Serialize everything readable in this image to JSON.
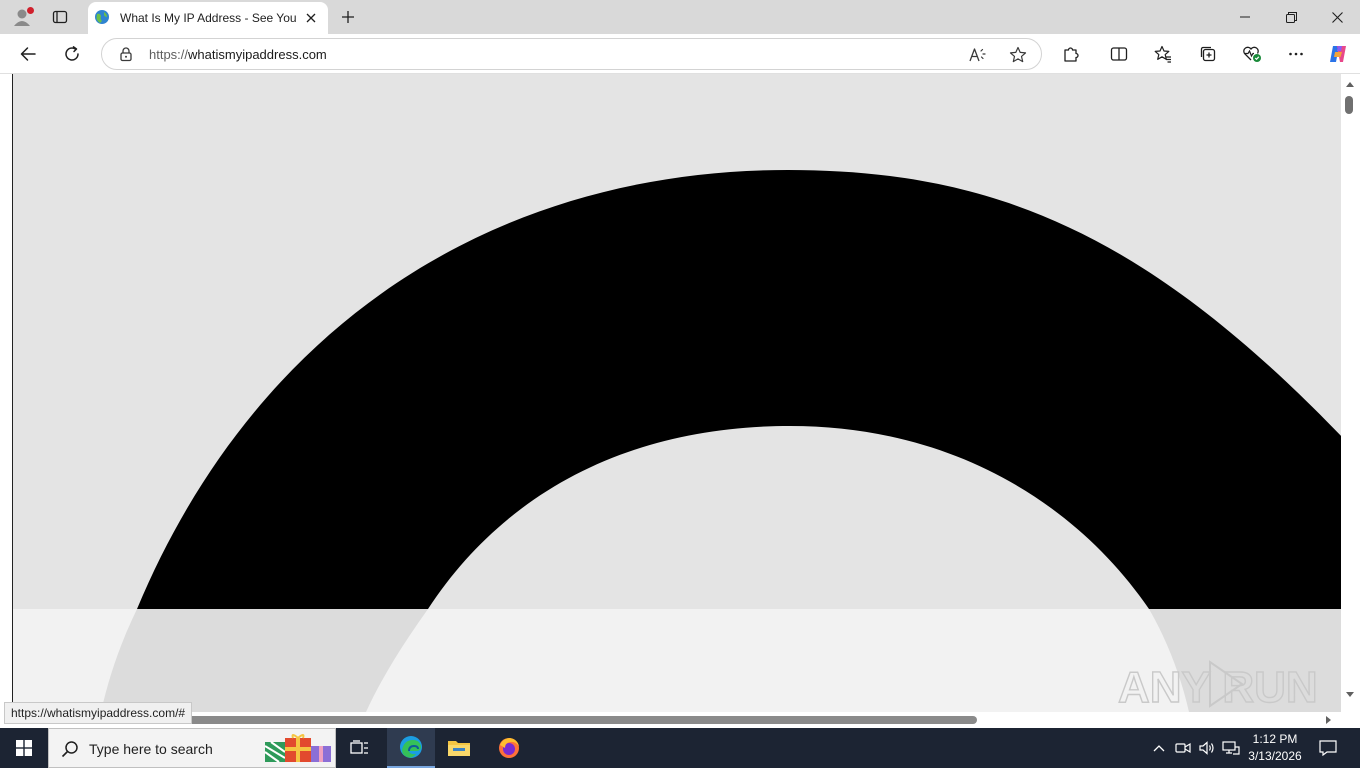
{
  "browser": {
    "tab": {
      "title": "What Is My IP Address - See Your"
    },
    "address_bar": {
      "url_scheme": "https://",
      "url_host": "whatismyipaddress.com"
    },
    "status_bar_url": "https://whatismyipaddress.com/#"
  },
  "page": {
    "arc_color": "#000000",
    "background_color": "#e4e4e4",
    "lower_band_color": "#f2f2f2"
  },
  "watermark": {
    "text": "ANY RUN"
  },
  "taskbar": {
    "search_placeholder": "Type here to search",
    "time": "1:12 PM",
    "date": "3/13/2026"
  },
  "icons": {
    "profile": "profile-icon",
    "tab_actions": "tab-actions-icon",
    "favicon": "globe-icon",
    "close_tab": "close-icon",
    "new_tab": "plus-icon",
    "minimize": "minimize-icon",
    "restore": "restore-icon",
    "close_window": "close-icon",
    "back": "back-arrow-icon",
    "refresh": "refresh-icon",
    "lock": "lock-icon",
    "read_aloud": "read-aloud-icon",
    "favorite": "star-icon",
    "extensions": "puzzle-icon",
    "split_screen": "split-screen-icon",
    "favorites": "favorites-icon",
    "collections": "collections-icon",
    "browser_essentials": "heart-pulse-icon",
    "more": "more-icon",
    "copilot": "copilot-icon",
    "windows_start": "windows-logo-icon",
    "task_view": "task-view-icon",
    "edge": "edge-icon",
    "file_explorer": "folder-icon",
    "firefox": "firefox-icon",
    "tray_overflow": "chevron-up-icon",
    "meet": "camera-icon",
    "volume": "speaker-icon",
    "network": "network-icon",
    "notifications": "notification-icon"
  }
}
